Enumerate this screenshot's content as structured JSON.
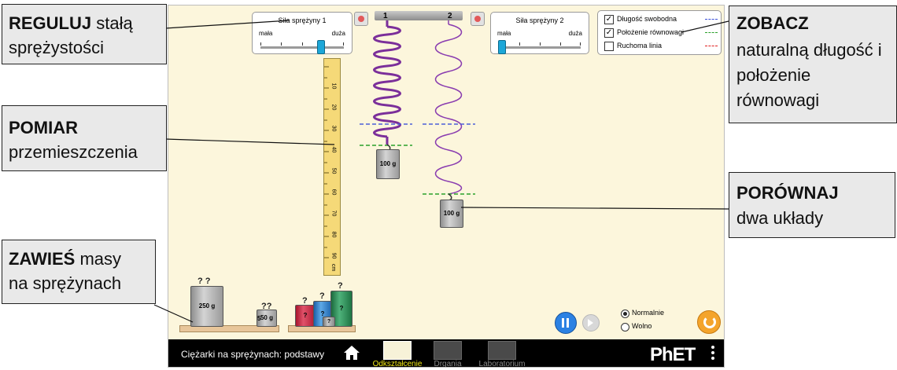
{
  "app": {
    "title": "Ciężarki na sprężynach: podstawy",
    "screens": [
      {
        "label": "Odkształcenie",
        "selected": true
      },
      {
        "label": "Drgania",
        "selected": false
      },
      {
        "label": "Laboratorium",
        "selected": false
      }
    ],
    "brand": "PhET",
    "icons": {
      "home": "home-icon",
      "menu": "menu-dots-icon",
      "reset": "reset-icon",
      "pause": "pause-icon",
      "step": "step-icon"
    }
  },
  "spring1_slider": {
    "title": "Siła sprężyny 1",
    "min_label": "mała",
    "max_label": "duża",
    "value": 0.85
  },
  "spring2_slider": {
    "title": "Siła sprężyny 2",
    "min_label": "mała",
    "max_label": "duża",
    "value": 0.1
  },
  "ceiling": {
    "label1": "1",
    "label2": "2"
  },
  "visibility": {
    "items": [
      {
        "label": "Długość swobodna",
        "checked": true,
        "color": "#3b4fd8"
      },
      {
        "label": "Położenie równowagi",
        "checked": true,
        "color": "#2aa02a"
      },
      {
        "label": "Ruchoma linia",
        "checked": false,
        "color": "#e02020"
      }
    ]
  },
  "ruler": {
    "ticks": [
      "10",
      "20",
      "30",
      "40",
      "50",
      "60",
      "70",
      "80",
      "90"
    ],
    "unit": "cm"
  },
  "masses": {
    "attached1": "100 g",
    "attached2": "100 g",
    "shelf1": [
      {
        "label": "250 g",
        "q": "? ?"
      },
      {
        "label": "50 g",
        "q": "??"
      },
      {
        "label": "50 g",
        "q": "5"
      }
    ],
    "shelf2": [
      {
        "label": "?",
        "q": "?"
      },
      {
        "label": "?",
        "q": "?"
      },
      {
        "label": "?",
        "q": "?"
      },
      {
        "label": "?",
        "q": "?"
      }
    ]
  },
  "speed": {
    "normal_label": "Normalnie",
    "slow_label": "Wolno",
    "selected": "normal"
  },
  "callouts": {
    "adjust_bold": "REGULUJ",
    "adjust_rest1": " stałą",
    "adjust_line2": "sprężystości",
    "measure_bold": "POMIAR",
    "measure_line2": "przemieszczenia",
    "hang_bold": "ZAWIEŚ",
    "hang_rest1": " masy",
    "hang_line2": "na sprężynach",
    "see_bold": "ZOBACZ",
    "see_line2": "naturalną długość i",
    "see_line3": "położenie",
    "see_line4": "równowagi",
    "compare_bold": "PORÓWNAJ",
    "compare_line2": "dwa układy"
  }
}
